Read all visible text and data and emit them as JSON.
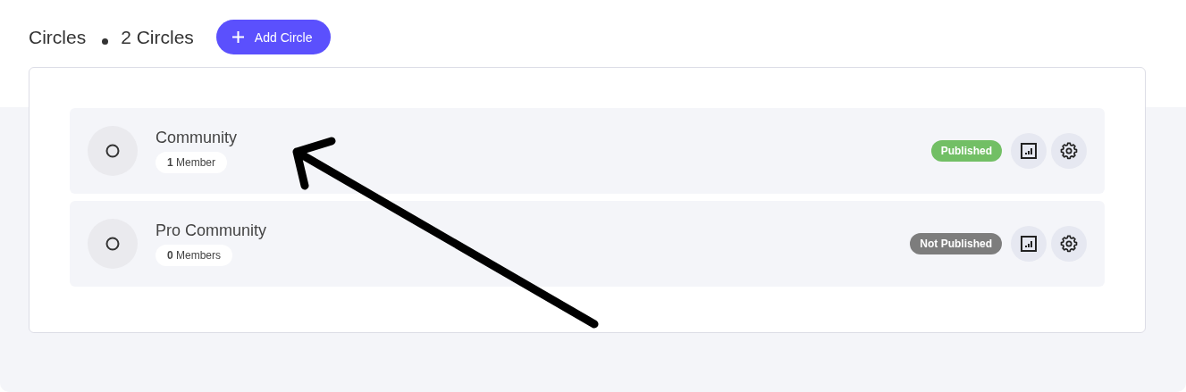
{
  "header": {
    "title": "Circles",
    "count": "2 Circles",
    "add_button": "Add Circle"
  },
  "circles": [
    {
      "name": "Community",
      "members": "**1** Member",
      "status": "Published",
      "published": true
    },
    {
      "name": "Pro Community",
      "members": "**0** Members",
      "status": "Not Published",
      "published": false
    }
  ]
}
